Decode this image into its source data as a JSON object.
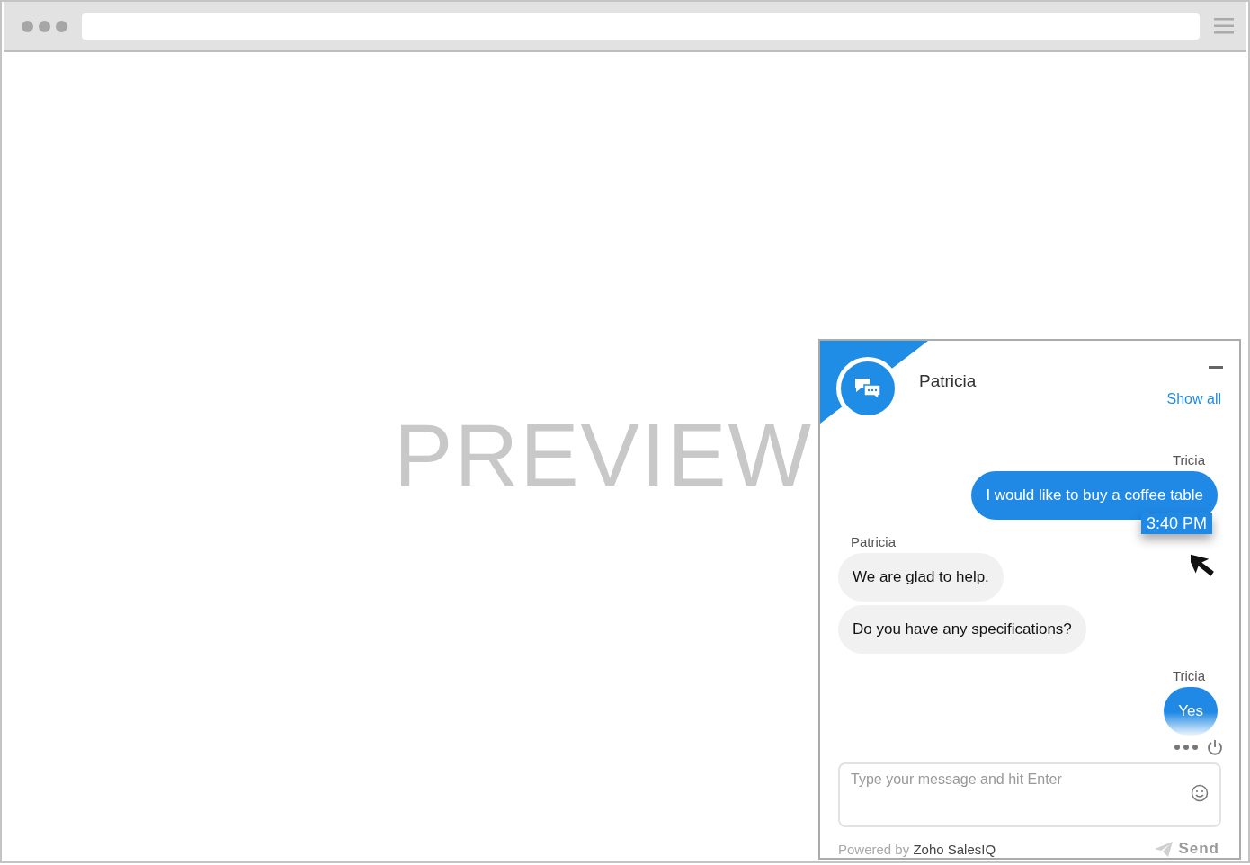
{
  "preview_label": "PREVIEW",
  "chat": {
    "agent_name": "Patricia",
    "show_all_link": "Show all",
    "groups": [
      {
        "kind": "outgoing",
        "sender": "Tricia",
        "bubbles": [
          {
            "text": "I would like to buy a coffee table",
            "time": "3:40 PM"
          }
        ]
      },
      {
        "kind": "incoming",
        "sender": "Patricia",
        "bubbles": [
          {
            "text": "We are glad to help."
          },
          {
            "text": "Do you have any specifications?"
          }
        ]
      },
      {
        "kind": "outgoing",
        "sender": "Tricia",
        "bubbles": [
          {
            "text": "Yes"
          }
        ]
      }
    ],
    "input": {
      "placeholder": "Type your message and hit Enter"
    },
    "powered_by": "Powered by",
    "brand": "Zoho SalesIQ",
    "send_button": "Send"
  }
}
